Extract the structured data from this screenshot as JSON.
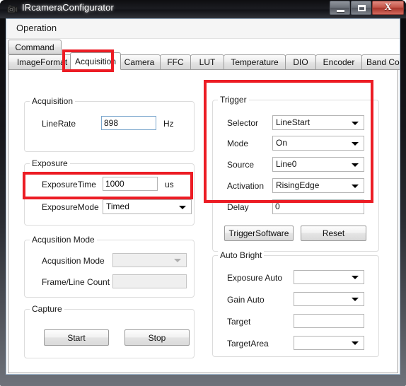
{
  "window": {
    "title": "IRcameraConfigurator",
    "icon": "camera-icon",
    "buttons": {
      "minimize": "minimize-icon",
      "maximize": "maximize-icon",
      "close": "X"
    }
  },
  "menubar": {
    "items": [
      "Operation"
    ]
  },
  "tabs": {
    "top_row": [
      {
        "label": "Command",
        "selected": false
      }
    ],
    "bottom_row": [
      {
        "label": "ImageFormat",
        "selected": false
      },
      {
        "label": "Acquisition",
        "selected": true
      },
      {
        "label": "Camera",
        "selected": false
      },
      {
        "label": "FFC",
        "selected": false
      },
      {
        "label": "LUT",
        "selected": false
      },
      {
        "label": "Temperature",
        "selected": false
      },
      {
        "label": "DIO",
        "selected": false
      },
      {
        "label": "Encoder",
        "selected": false
      },
      {
        "label": "Band Control",
        "selected": false
      }
    ]
  },
  "groups": {
    "acquisition": {
      "title": "Acquisition",
      "line_rate_label": "LineRate",
      "line_rate_value": "898",
      "line_rate_unit": "Hz"
    },
    "exposure": {
      "title": "Exposure",
      "exposure_time_label": "ExposureTime",
      "exposure_time_value": "1000",
      "exposure_time_unit": "us",
      "exposure_mode_label": "ExposureMode",
      "exposure_mode_value": "Timed"
    },
    "acquisition_mode": {
      "title": "Acqusition Mode",
      "mode_label": "Acqusition Mode",
      "mode_value": "",
      "frame_line_count_label": "Frame/Line Count",
      "frame_line_count_value": ""
    },
    "capture": {
      "title": "Capture",
      "start_label": "Start",
      "stop_label": "Stop"
    },
    "trigger": {
      "title": "Trigger",
      "selector_label": "Selector",
      "selector_value": "LineStart",
      "mode_label": "Mode",
      "mode_value": "On",
      "source_label": "Source",
      "source_value": "Line0",
      "activation_label": "Activation",
      "activation_value": "RisingEdge",
      "delay_label": "Delay",
      "delay_value": "0",
      "trigger_software_label": "TriggerSoftware",
      "reset_label": "Reset"
    },
    "auto_bright": {
      "title": "Auto Bright",
      "exposure_auto_label": "Exposure Auto",
      "exposure_auto_value": "",
      "gain_auto_label": "Gain Auto",
      "gain_auto_value": "",
      "target_label": "Target",
      "target_value": "",
      "target_area_label": "TargetArea",
      "target_area_value": ""
    }
  },
  "annotations": {
    "highlight_color": "#ec1c24",
    "boxes": [
      "acquisition-tab",
      "exposure-mode-row",
      "trigger-group"
    ]
  }
}
